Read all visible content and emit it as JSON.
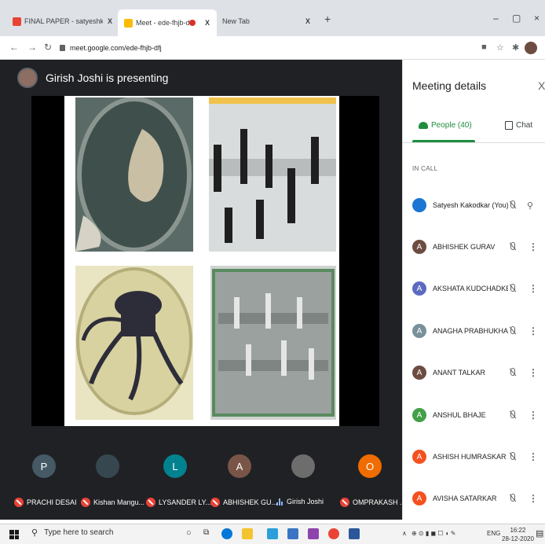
{
  "browser": {
    "tabs": [
      {
        "title": "FINAL PAPER - satyeshk@gmail.c",
        "close": "X",
        "favicon_color": "#ea4335"
      },
      {
        "title": "Meet - ede-fhjb-dfj",
        "close": "X",
        "favicon_color": "#fbbc04"
      },
      {
        "title": "New Tab",
        "close": "X"
      }
    ],
    "new_tab": "+",
    "window_controls": [
      "–",
      "▢",
      "×"
    ],
    "url": "meet.google.com/ede-fhjb-dfj"
  },
  "meet": {
    "presenting_banner": "Girish Joshi is presenting",
    "participants_strip": [
      {
        "initial": "P",
        "name": "PRACHI DESAI",
        "color": "#455a64",
        "muted": true
      },
      {
        "initial": "",
        "name": "Kishan Mangu...",
        "color": "#37474f",
        "muted": true
      },
      {
        "initial": "L",
        "name": "LYSANDER LY...",
        "color": "#00838f",
        "muted": true
      },
      {
        "initial": "A",
        "name": "ABHISHEK GU...",
        "color": "#795548",
        "muted": true
      },
      {
        "initial": "",
        "name": "Girish Joshi",
        "color": "#6d6d6d",
        "muted": false
      },
      {
        "initial": "O",
        "name": "OMPRAKASH ...",
        "color": "#ef6c00",
        "muted": true
      }
    ]
  },
  "panel": {
    "title": "Meeting details",
    "close": "X",
    "tabs": {
      "people": "People (40)",
      "chat": "Chat"
    },
    "section_label": "IN CALL",
    "people": [
      {
        "initial": "",
        "name": "Satyesh Kakodkar (You)",
        "color": "#1976d2",
        "pin": true
      },
      {
        "initial": "A",
        "name": "ABHISHEK GURAV",
        "color": "#6d4c41"
      },
      {
        "initial": "A",
        "name": "AKSHATA KUDCHADKER",
        "color": "#5c6bc0"
      },
      {
        "initial": "A",
        "name": "ANAGHA PRABHUKHA...",
        "color": "#78909c"
      },
      {
        "initial": "A",
        "name": "ANANT TALKAR",
        "color": "#6d4c41"
      },
      {
        "initial": "A",
        "name": "ANSHUL BHAJE",
        "color": "#43a047"
      },
      {
        "initial": "A",
        "name": "ASHISH HUMRASKAR",
        "color": "#f4511e"
      },
      {
        "initial": "A",
        "name": "AVISHA SATARKAR",
        "color": "#f4511e"
      }
    ]
  },
  "taskbar": {
    "search_placeholder": "Type here to search",
    "language": "ENG",
    "time": "16:22",
    "date": "28-12-2020"
  }
}
